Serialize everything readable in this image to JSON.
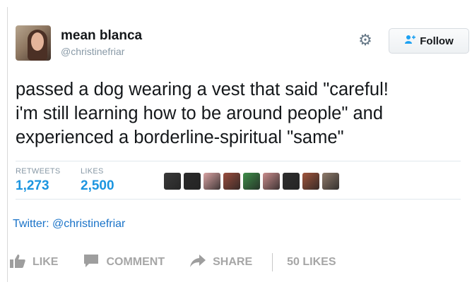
{
  "tweet": {
    "display_name": "mean blanca",
    "handle": "@christinefriar",
    "follow_label": "Follow",
    "text_lines": [
      "passed a dog wearing a vest that said \"careful!",
      "i'm still learning how to be around people\" and",
      "experienced a borderline-spiritual \"same\""
    ],
    "retweets_label": "RETWEETS",
    "retweets_count": "1,273",
    "likes_label": "LIKES",
    "likes_count": "2,500",
    "liker_avatar_colors": [
      "#3a3a3a",
      "#2b2b2b",
      "#d9a3a3",
      "#9b4d3e",
      "#3f8f4a",
      "#c98c8c",
      "#2f2f2f",
      "#a1553c",
      "#8f7b6b"
    ]
  },
  "source": "Twitter: @christinefriar",
  "actions": {
    "like": "LIKE",
    "comment": "COMMENT",
    "share": "SHARE",
    "likes_count": "50 LIKES"
  },
  "colors": {
    "link_blue": "#1b95e0",
    "source_blue": "#1a73c8",
    "text": "#14171a",
    "muted": "#8899a6"
  },
  "icons": {
    "gear": "gear-icon",
    "follow": "add-user-icon",
    "like": "thumbs-up-icon",
    "comment": "comment-bubble-icon",
    "share": "share-arrow-icon"
  }
}
